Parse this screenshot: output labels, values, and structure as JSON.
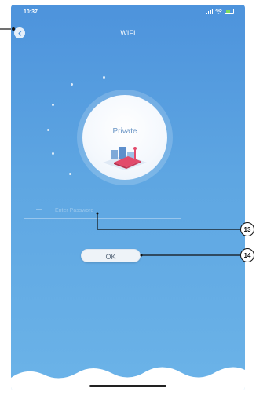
{
  "status_bar": {
    "time": "10:37",
    "icons": [
      "signal-icon",
      "wifi-icon",
      "battery-icon"
    ]
  },
  "header": {
    "title": "WiFi",
    "back_icon": "chevron-left-icon"
  },
  "network": {
    "name": "Private",
    "illustration": "router-illustration"
  },
  "password": {
    "placeholder": "Enter Password",
    "value": "",
    "icon": "lock-icon"
  },
  "ok_button": {
    "label": "OK"
  },
  "callouts": [
    "13",
    "14"
  ],
  "colors": {
    "background_top": "#4d93dc",
    "background_bottom": "#6bb3e8",
    "button_bg": "#eef3f8",
    "network_name": "#6a95c5"
  }
}
